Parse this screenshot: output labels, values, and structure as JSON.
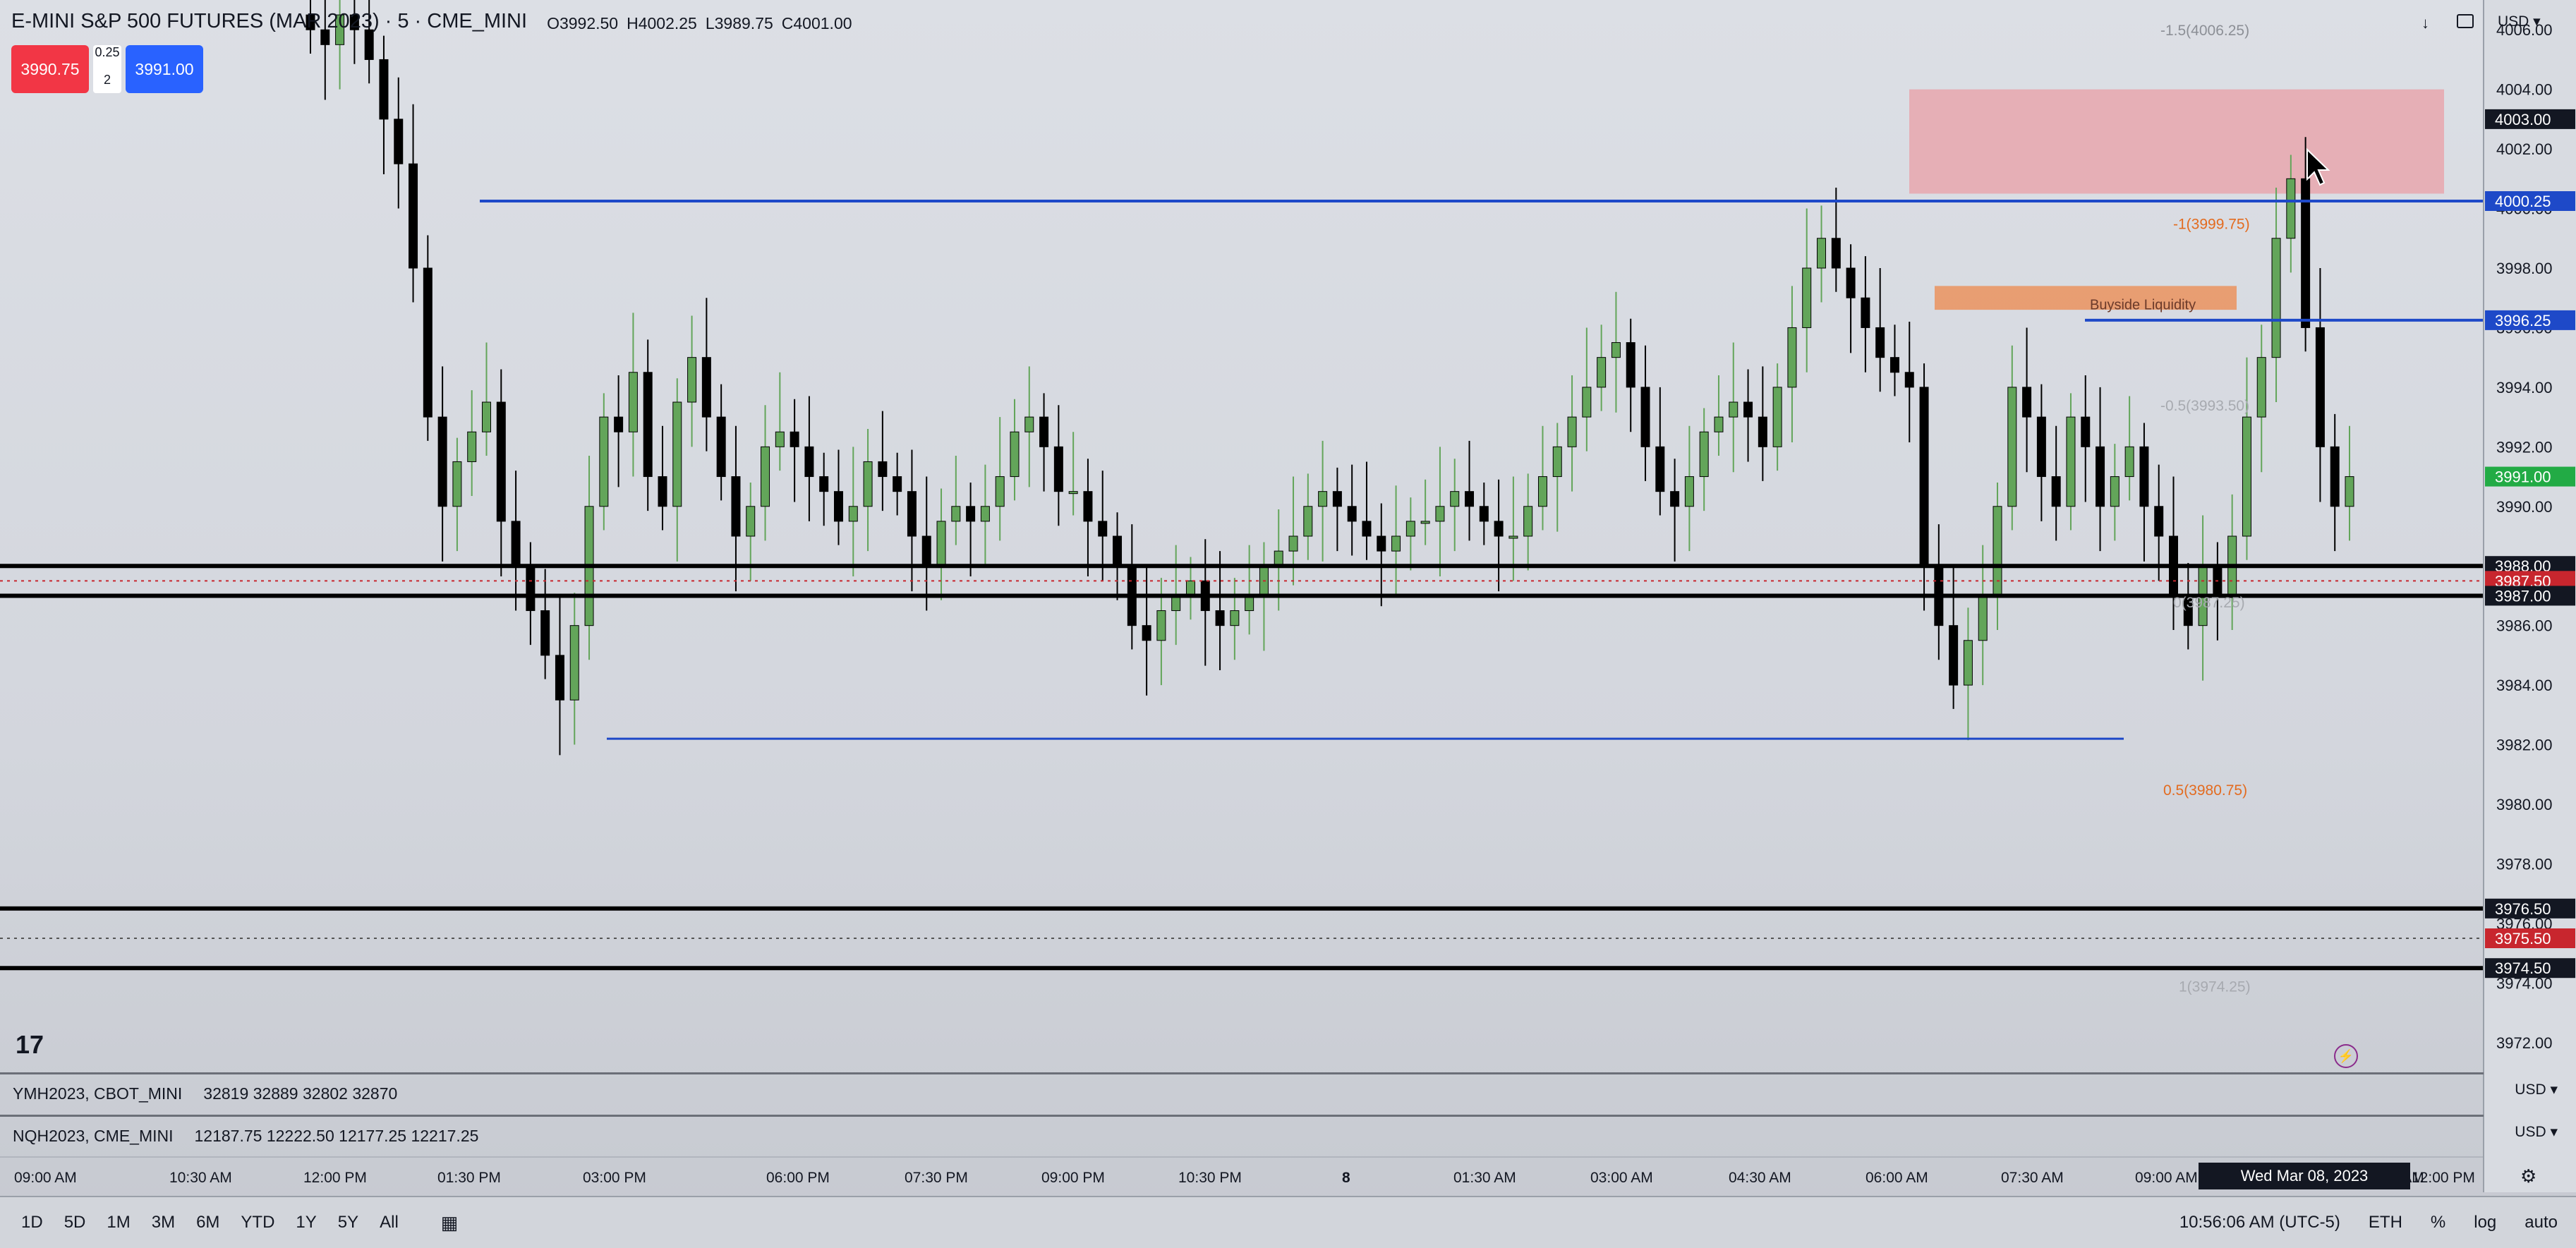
{
  "header": {
    "symbol": "E-MINI S&P 500 FUTURES (MAR 2023) · 5 · CME_MINI",
    "open": "O3992.50",
    "high": "H4002.25",
    "low": "L3989.75",
    "close": "C4001.00"
  },
  "trade": {
    "sell_price": "3990.75",
    "spread": "0.25",
    "qty": "2",
    "buy_price": "3991.00",
    "sell_color": "#f23645",
    "buy_color": "#2962ff"
  },
  "top_right": {
    "currency": "USD ▾",
    "arrow_icon": "arrow-down-icon",
    "screenshot_icon": "fullscreen-icon"
  },
  "chart_data": {
    "type": "candlestick",
    "symbol": "ESH2023",
    "ylim": [
      3971,
      4007
    ],
    "y_ticks": [
      "4006.00",
      "4004.00",
      "4002.00",
      "4000.00",
      "3998.00",
      "3996.00",
      "3994.00",
      "3992.00",
      "3990.00",
      "3988.00",
      "3986.00",
      "3984.00",
      "3982.00",
      "3980.00",
      "3978.00",
      "3976.00",
      "3974.00",
      "3972.00"
    ],
    "x_ticks": [
      "09:00 AM",
      "10:30 AM",
      "12:00 PM",
      "01:30 PM",
      "03:00 PM",
      "06:00 PM",
      "07:30 PM",
      "09:00 PM",
      "10:30 PM",
      "8",
      "01:30 AM",
      "03:00 AM",
      "04:30 AM",
      "06:00 AM",
      "07:30 AM",
      "09:00 AM",
      "Wed Mar 08, 2023",
      "10:30 AM",
      "12:00 PM"
    ],
    "closes": [
      4006,
      4005.5,
      4006.5,
      4006,
      4005,
      4003,
      4001.5,
      3998,
      3993,
      3990,
      3991.5,
      3992.5,
      3993.5,
      3989.5,
      3988,
      3986.5,
      3985,
      3983.5,
      3986,
      3990,
      3993,
      3992.5,
      3994.5,
      3991,
      3990,
      3993.5,
      3995,
      3993,
      3991,
      3989,
      3990,
      3992,
      3992.5,
      3992,
      3991,
      3990.5,
      3989.5,
      3990,
      3991.5,
      3991,
      3990.5,
      3989,
      3988,
      3989.5,
      3990,
      3989.5,
      3990,
      3991,
      3992.5,
      3993,
      3992,
      3990.5,
      3990.5,
      3989.5,
      3989,
      3988,
      3986,
      3985.5,
      3986.5,
      3987,
      3987.5,
      3986.5,
      3986,
      3986.5,
      3987,
      3988,
      3988.5,
      3989,
      3990,
      3990.5,
      3990,
      3989.5,
      3989,
      3988.5,
      3989,
      3989.5,
      3989.5,
      3990,
      3990.5,
      3990,
      3989.5,
      3989,
      3989,
      3990,
      3991,
      3992,
      3993,
      3994,
      3995,
      3995.5,
      3994,
      3992,
      3990.5,
      3990,
      3991,
      3992.5,
      3993,
      3993.5,
      3993,
      3992,
      3994,
      3996,
      3998,
      3999,
      3998,
      3997,
      3996,
      3995,
      3994.5,
      3994,
      3988,
      3986,
      3984,
      3985.5,
      3987,
      3990,
      3994,
      3993,
      3991,
      3990,
      3993,
      3992,
      3990,
      3991,
      3992,
      3990,
      3989,
      3987,
      3986,
      3988,
      3987,
      3989,
      3993,
      3995,
      3999,
      4001,
      3996,
      3992,
      3990,
      3991
    ],
    "levels": {
      "blue_lines": [
        "4000.25",
        "3996.25"
      ],
      "black_lines": [
        "3988.00",
        "3987.00",
        "3976.50",
        "3974.50"
      ],
      "blue_low_line": 3982.2,
      "premium_zone": [
        4000.5,
        4004
      ],
      "buyside_zone": [
        3996.6,
        3997.4
      ]
    },
    "annotations": {
      "fib_m15": "-1.5(4006.25)",
      "fib_m1": "-1(3999.75)",
      "fib_m05": "-0.5(3993.50)",
      "fib_0": "0(3987.25)",
      "fib_05": "0.5(3980.75)",
      "fib_1": "1(3974.25)",
      "buyside": "Buyside Liquidity"
    },
    "price_labels": [
      {
        "value": "4003.00",
        "color": "#131722"
      },
      {
        "value": "4000.25",
        "color": "#1e49c8"
      },
      {
        "value": "3996.25",
        "color": "#1e49c8"
      },
      {
        "value": "3991.00",
        "color": "#22ab45"
      },
      {
        "value": "3988.00",
        "color": "#131722"
      },
      {
        "value": "3987.50",
        "color": "#c8262e"
      },
      {
        "value": "3987.00",
        "color": "#131722"
      },
      {
        "value": "3976.50",
        "color": "#131722"
      },
      {
        "value": "3975.50",
        "color": "#c8262e"
      },
      {
        "value": "3974.50",
        "color": "#131722"
      }
    ],
    "up_color": "#63a55a",
    "down_color": "#000000"
  },
  "subpanes": [
    {
      "symbol": "YMH2023, CBOT_MINI",
      "values": "32819  32889  32802  32870",
      "currency": "USD ▾"
    },
    {
      "symbol": "NQH2023, CME_MINI",
      "values": "12187.75  12222.50  12177.25  12217.25",
      "currency": "USD ▾"
    }
  ],
  "crosshair_date": "Wed Mar 08, 2023",
  "bottom_bar": {
    "timeframes": [
      "1D",
      "5D",
      "1M",
      "3M",
      "6M",
      "YTD",
      "1Y",
      "5Y",
      "All"
    ],
    "clock": "10:56:06 AM (UTC-5)",
    "session": "ETH",
    "percent": "%",
    "log": "log",
    "auto": "auto"
  },
  "logo_text": "17"
}
